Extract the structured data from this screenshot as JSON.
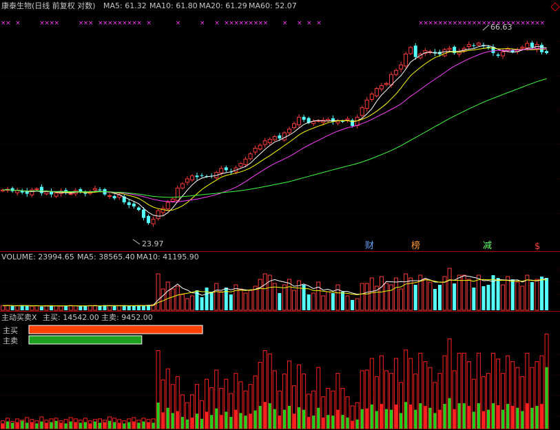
{
  "header": {
    "title": "康泰生物(日线 前复权 对数)",
    "ma_items": [
      {
        "label": "MA5: 61.32",
        "color": "#ffffff"
      },
      {
        "label": "MA10: 61.80",
        "color": "#ffff00"
      },
      {
        "label": "MA20: 61.29",
        "color": "#ff40ff"
      },
      {
        "label": "MA60: 52.07",
        "color": "#40ff40"
      }
    ]
  },
  "volume_header": {
    "title": "VOLUME: 23994.65",
    "ma5": "MA5: 38565.40",
    "ma10": "MA10: 41195.90"
  },
  "flow_header": {
    "title": "主动买卖X",
    "buy": "主买: 14542.00",
    "sell": "主卖: 9452.00"
  },
  "flow_legend": {
    "buy_label": "主买",
    "sell_label": "主卖",
    "buy_value": 14542,
    "sell_value": 9452,
    "buy_color": "#ff4000",
    "sell_color": "#20a020"
  },
  "annotations": {
    "high": "66.63",
    "low": "23.97",
    "markers": [
      {
        "label": "财",
        "color": "#6aa6ff"
      },
      {
        "label": "榜",
        "color": "#ff9933"
      },
      {
        "label": "减",
        "color": "#66ff66"
      },
      {
        "label": "$",
        "color": "#ff4040"
      }
    ]
  },
  "chart_data": {
    "type": "candlestick",
    "price_scale": "log",
    "price_range": [
      22,
      72
    ],
    "up_color": "#ff3b3b",
    "down_color": "#55ffff",
    "ma_colors": {
      "ma5": "#ffffff",
      "ma10": "#ffff00",
      "ma20": "#ff40ff",
      "ma60": "#40ff40"
    },
    "close": [
      29.2,
      29.3,
      29.0,
      29.1,
      28.8,
      28.6,
      29.2,
      29.4,
      28.7,
      28.9,
      28.5,
      28.7,
      29.0,
      28.8,
      28.6,
      29.1,
      28.9,
      28.6,
      28.9,
      29.4,
      29.2,
      28.5,
      28.3,
      27.9,
      28.4,
      27.3,
      26.9,
      26.7,
      26.2,
      25.1,
      24.4,
      24.9,
      26.1,
      26.4,
      27.3,
      27.8,
      29.5,
      30.2,
      31.0,
      31.5,
      31.3,
      31.6,
      31.4,
      31.5,
      32.1,
      32.8,
      32.5,
      32.2,
      32.9,
      33.7,
      34.5,
      35.5,
      36.6,
      37.2,
      38.1,
      38.4,
      39.0,
      38.6,
      39.8,
      40.6,
      41.8,
      43.3,
      42.7,
      42.0,
      42.3,
      42.5,
      42.6,
      42.8,
      42.3,
      42.4,
      42.3,
      42.9,
      41.3,
      43.3,
      45.6,
      47.5,
      49.1,
      50.6,
      51.4,
      52.0,
      54.6,
      55.8,
      57.5,
      61.0,
      63.2,
      60.0,
      61.0,
      62.1,
      61.8,
      61.3,
      60.9,
      62.5,
      62.9,
      61.3,
      61.9,
      62.9,
      64.2,
      63.8,
      64.7,
      63.6,
      63.0,
      61.3,
      60.4,
      61.7,
      62.7,
      61.7,
      62.3,
      63.3,
      64.6,
      63.3,
      64.2,
      61.6,
      61.3
    ],
    "volume": [
      3900,
      4100,
      3600,
      3700,
      4200,
      3800,
      3500,
      3700,
      3300,
      3900,
      4100,
      3700,
      3500,
      3600,
      4000,
      3800,
      3400,
      3700,
      3900,
      4000,
      3600,
      4200,
      3900,
      3500,
      3800,
      4100,
      3700,
      3900,
      4200,
      3800,
      4400,
      4600,
      27000,
      16000,
      21000,
      16000,
      18000,
      12000,
      9000,
      11000,
      15000,
      10000,
      17000,
      14000,
      20000,
      14000,
      17000,
      12000,
      19000,
      16000,
      13000,
      15000,
      18000,
      23000,
      27000,
      26000,
      20000,
      13000,
      19000,
      23000,
      15000,
      22000,
      19000,
      12000,
      13000,
      21000,
      11000,
      14000,
      13000,
      19000,
      14000,
      11000,
      8000,
      9000,
      20000,
      20000,
      24000,
      18000,
      25000,
      20000,
      19000,
      24000,
      16000,
      27000,
      24000,
      19000,
      26000,
      23000,
      21000,
      16000,
      19000,
      25000,
      31000,
      20000,
      26000,
      26000,
      23000,
      17000,
      26000,
      18000,
      19000,
      26000,
      24000,
      19000,
      25000,
      23000,
      21000,
      18000,
      26000,
      21000,
      23000,
      25000,
      24000
    ],
    "vol_ma5": [
      3900,
      4000,
      3870,
      3825,
      3900,
      3880,
      3760,
      3780,
      3700,
      3640,
      3700,
      3740,
      3700,
      3760,
      3780,
      3720,
      3660,
      3700,
      3760,
      3780,
      3720,
      3780,
      3920,
      3840,
      3800,
      3900,
      3800,
      3780,
      3840,
      3900,
      4040,
      4180,
      8040,
      11160,
      14620,
      16880,
      19600,
      16600,
      15200,
      13200,
      13000,
      11400,
      12400,
      13400,
      15200,
      15000,
      16400,
      15400,
      16400,
      15800,
      15400,
      15000,
      15800,
      17000,
      19200,
      21800,
      22800,
      21800,
      21000,
      20200,
      18000,
      18400,
      19600,
      18200,
      16200,
      17400,
      15200,
      15800,
      14400,
      15600,
      14200,
      14200,
      13000,
      12200,
      12400,
      13600,
      14200,
      15000,
      17400,
      21400,
      21200,
      21000,
      21400,
      21200,
      22000,
      22000,
      22000,
      23800,
      22600,
      21000,
      21000,
      20800,
      22400,
      22400,
      24200,
      25600,
      25200,
      24400,
      23600,
      22000,
      22200,
      21400,
      22800,
      22600,
      22400,
      22400,
      22600,
      21000,
      22600,
      22400,
      21800,
      22600,
      23800
    ],
    "vol_ma10": [
      3900,
      4000,
      3870,
      3825,
      3900,
      3880,
      3820,
      3810,
      3750,
      3770,
      3790,
      3760,
      3750,
      3730,
      3740,
      3760,
      3760,
      3760,
      3780,
      3790,
      3760,
      3800,
      3800,
      3780,
      3800,
      3810,
      3800,
      3810,
      3850,
      3830,
      3920,
      3970,
      6210,
      7410,
      9110,
      10270,
      11570,
      12310,
      12870,
      13560,
      14560,
      14050,
      14000,
      13230,
      14170,
      13630,
      14270,
      13870,
      14950,
      15120,
      14920,
      15420,
      15520,
      16450,
      16150,
      17130,
      17430,
      17090,
      16800,
      17600,
      16950,
      16650,
      16400,
      16150,
      14800,
      14800,
      14400,
      13950,
      13800,
      13150,
      13150,
      12800,
      12200,
      11800,
      12500,
      12300,
      13200,
      13600,
      13800,
      14500,
      15000,
      17100,
      17500,
      19600,
      20100,
      20600,
      21600,
      22700,
      22300,
      21600,
      20900,
      21000,
      22700,
      22300,
      22200,
      22200,
      22300,
      21600,
      22700,
      22900,
      22600,
      23000,
      22200,
      22400,
      22200,
      21500,
      21800,
      21600,
      22600,
      22100,
      22100,
      22800,
      22400
    ],
    "flow_buy": [
      1200,
      1600,
      1100,
      1500,
      1300,
      1700,
      1400,
      1200,
      1800,
      1300,
      1500,
      1600,
      1200,
      1400,
      1700,
      1500,
      1300,
      1600,
      1200,
      1400,
      1500,
      1300,
      1800,
      1600,
      1400,
      1200,
      1500,
      1700,
      1300,
      1600,
      1400,
      1500,
      12000,
      7500,
      9200,
      6800,
      8000,
      5200,
      4000,
      5200,
      6800,
      4300,
      7600,
      6300,
      9000,
      6200,
      7600,
      5400,
      8500,
      7200,
      5800,
      6800,
      8100,
      10200,
      12000,
      11500,
      8900,
      5800,
      8400,
      10400,
      6600,
      9800,
      8400,
      5300,
      5800,
      9400,
      4900,
      6200,
      5800,
      8500,
      6200,
      4900,
      3500,
      4000,
      8900,
      9000,
      10800,
      8000,
      11200,
      8900,
      8500,
      10800,
      7100,
      12100,
      10800,
      8400,
      11600,
      10300,
      9400,
      7100,
      8500,
      11200,
      13800,
      8900,
      11600,
      11600,
      10300,
      7600,
      11600,
      8000,
      8500,
      11600,
      10700,
      8500,
      11200,
      10300,
      9400,
      8000,
      11600,
      9400,
      10300,
      11200,
      14542
    ],
    "flow_sell": [
      800,
      1100,
      900,
      1000,
      1200,
      900,
      1000,
      800,
      1100,
      900,
      1000,
      1200,
      900,
      800,
      1100,
      1000,
      900,
      1000,
      800,
      1100,
      900,
      1000,
      1200,
      1000,
      900,
      800,
      1000,
      1100,
      900,
      1100,
      1000,
      900,
      4000,
      2500,
      3200,
      2400,
      2700,
      1800,
      1400,
      1700,
      2300,
      1500,
      2600,
      2100,
      3100,
      2100,
      2600,
      1800,
      2900,
      2400,
      2000,
      2300,
      2800,
      3500,
      4100,
      3900,
      3000,
      2000,
      2900,
      3500,
      2300,
      3300,
      2900,
      1800,
      2000,
      3200,
      1700,
      2100,
      2000,
      2900,
      2100,
      1700,
      1200,
      1400,
      3000,
      3100,
      3700,
      2700,
      3800,
      3000,
      2900,
      3700,
      2400,
      4100,
      3700,
      2900,
      3900,
      3500,
      3200,
      2400,
      2900,
      3800,
      4700,
      3000,
      3900,
      3900,
      3500,
      2600,
      3900,
      2700,
      2900,
      3900,
      3600,
      2900,
      3800,
      3500,
      3200,
      2700,
      3900,
      3200,
      3500,
      3800,
      9452
    ]
  }
}
